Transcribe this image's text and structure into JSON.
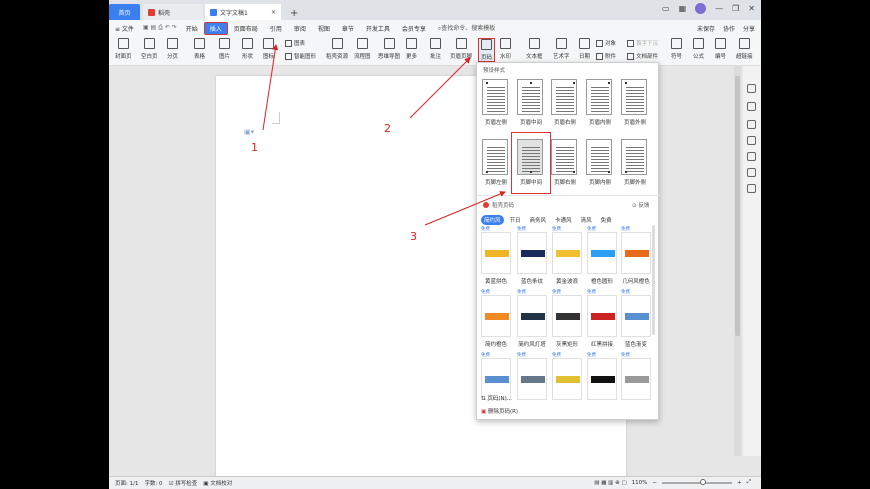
{
  "tabs": {
    "home": "首页",
    "shell": "稻壳",
    "doc": "文字文稿1"
  },
  "menu": {
    "file": "≡ 文件",
    "items": [
      "开始",
      "插入",
      "页面布局",
      "引用",
      "审阅",
      "视图",
      "章节",
      "开发工具",
      "会员专享"
    ],
    "search": "查找命令、搜索模板",
    "unsaved": "未保存",
    "collab": "协作",
    "share": "分享"
  },
  "ribbon": {
    "cover": "封面页",
    "blank": "空白页",
    "break": "分页",
    "table": "表格",
    "picture": "图片",
    "shape": "形状",
    "icons": "图标",
    "chart": "图表",
    "smart": "智能图形",
    "stock": "稻壳资源",
    "flow": "流程图",
    "mind": "思维导图",
    "more": "更多",
    "comment": "批注",
    "header": "页眉页脚",
    "pagenum": "页码",
    "watermark": "水印",
    "textbox": "文本框",
    "art": "艺术字",
    "date": "日期",
    "object": "对象",
    "attach": "附件",
    "firstcap": "首字下沉",
    "docpart": "文档部件",
    "symbol": "符号",
    "formula": "公式",
    "number": "编号",
    "hyperlink": "超链接"
  },
  "dropdown": {
    "preset_title": "预设样式",
    "row1": [
      "页眉左侧",
      "页眉中间",
      "页眉右侧",
      "页眉内侧",
      "页眉外侧"
    ],
    "row2": [
      "页脚左侧",
      "页脚中间",
      "页脚右侧",
      "页脚内侧",
      "页脚外侧"
    ],
    "shell_title": "稻壳页码",
    "feedback": "反馈",
    "cats": [
      "简约风",
      "节日",
      "商务风",
      "卡通风",
      "清风",
      "免费"
    ],
    "free": "免费",
    "row3": [
      "黄蓝拼色",
      "蓝色条纹",
      "黄金波浪",
      "橙色圆形",
      "几何风橙色"
    ],
    "row4": [
      "简约橙色",
      "简约风灯塔",
      "灰黑矩形",
      "红黑拼接",
      "蓝色渐变"
    ],
    "pagenum_menu": "页码(N)...",
    "delete": "删除页码(R)"
  },
  "status": {
    "page": "页面: 1/1",
    "words": "字数: 0",
    "spell": "拼写检查",
    "proof": "文档校对",
    "zoom": "110%"
  },
  "annotations": [
    "1",
    "2",
    "3"
  ],
  "colors": {
    "accent": "#3a7ef0",
    "annotation": "#dd2222"
  }
}
